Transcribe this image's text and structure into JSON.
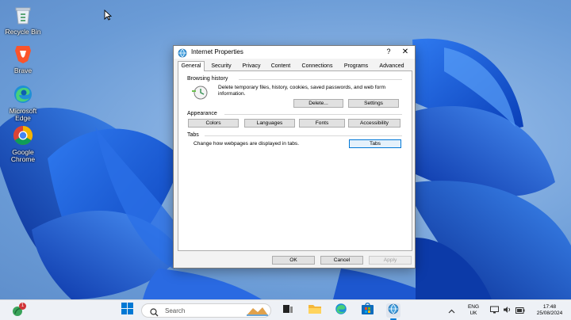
{
  "desktop": {
    "icons": [
      {
        "label": "Recycle Bin",
        "icon": "recycle-bin-icon"
      },
      {
        "label": "Brave",
        "icon": "brave-icon"
      },
      {
        "label": "Microsoft Edge",
        "icon": "edge-icon"
      },
      {
        "label": "Google Chrome",
        "icon": "chrome-icon"
      }
    ]
  },
  "dialog": {
    "title": "Internet Properties",
    "help": "?",
    "close": "✕",
    "tabs": [
      "General",
      "Security",
      "Privacy",
      "Content",
      "Connections",
      "Programs",
      "Advanced"
    ],
    "active_tab": "General",
    "browsing_history": {
      "label": "Browsing history",
      "description": "Delete temporary files, history, cookies, saved passwords, and web form information.",
      "delete_button": "Delete...",
      "settings_button": "Settings"
    },
    "appearance": {
      "label": "Appearance",
      "buttons": [
        "Colors",
        "Languages",
        "Fonts",
        "Accessibility"
      ]
    },
    "tabs_group": {
      "label": "Tabs",
      "description": "Change how webpages are displayed in tabs.",
      "tabs_button": "Tabs"
    },
    "footer": {
      "ok": "OK",
      "cancel": "Cancel",
      "apply": "Apply"
    }
  },
  "taskbar": {
    "search_placeholder": "Search",
    "language": "ENG",
    "region": "UK",
    "time": "17:48",
    "date": "25/08/2024",
    "widget_badge": "1"
  },
  "colors": {
    "accent": "#0078d7",
    "wallpaper": "#1e5fd6"
  }
}
